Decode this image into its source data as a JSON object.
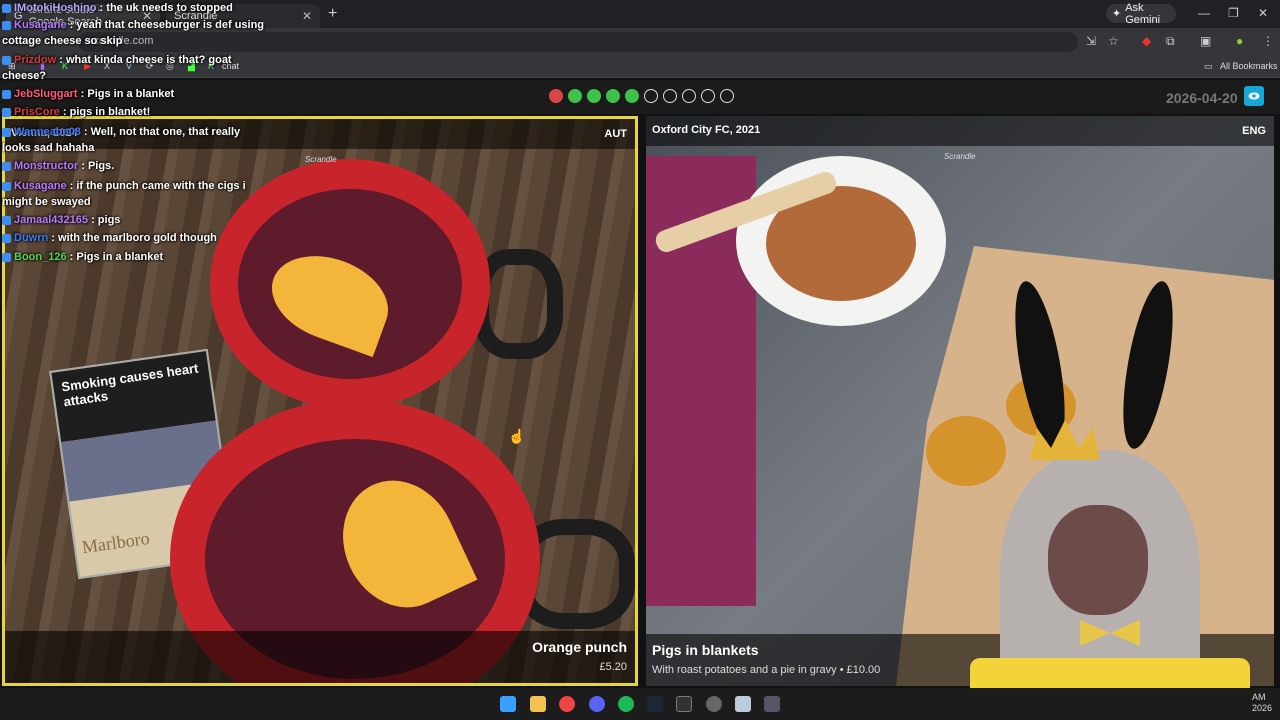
{
  "browser": {
    "tabs": [
      {
        "label": "akrane studio - Google Search"
      },
      {
        "label": "Scrandle"
      }
    ],
    "ask_gemini": "Ask Gemini",
    "url": "scrandle.com",
    "all_bookmarks": "All Bookmarks",
    "bookmark_chat": "chat"
  },
  "game": {
    "progress": [
      "red",
      "green",
      "green",
      "green",
      "green",
      "empty",
      "empty",
      "empty",
      "empty",
      "empty"
    ],
    "date": "2026-04-20",
    "colors": {
      "accent": "#e4d63b",
      "red": "#d94848",
      "green": "#3fc24b",
      "eye": "#15a7d6"
    },
    "left": {
      "location": "Vienna, 2024",
      "lang": "AUT",
      "watermark": "Scrandle",
      "title": "Orange punch",
      "price": "£5.20"
    },
    "right": {
      "location": "Oxford City FC, 2021",
      "lang": "ENG",
      "watermark": "Scrandle",
      "title": "Pigs in blankets",
      "subtitle": "With roast potatoes and a pie in gravy • £10.00"
    }
  },
  "chat": {
    "messages": [
      {
        "user": "IMotokiHoshino",
        "color": "#b9a6ff",
        "text": ": the uk needs to stopped"
      },
      {
        "user": "Kusagane",
        "color": "#b57bff",
        "text": ": yeah that cheeseburger is def using cottage cheese so skip"
      },
      {
        "user": "Prizdow",
        "color": "#d63a3a",
        "text": ": what kinda cheese is that? goat cheese?"
      },
      {
        "user": "JebSluggart",
        "color": "#ff5a7a",
        "text": ": Pigs in a blanket"
      },
      {
        "user": "PrisCore",
        "color": "#d63a3a",
        "text": ": pigs in blanket!"
      },
      {
        "user": "Wanneabe08",
        "color": "#3e7bff",
        "text": ": Well, not that one, that really looks sad hahaha"
      },
      {
        "user": "Monstructor",
        "color": "#b57bff",
        "text": ": Pigs."
      },
      {
        "user": "Kusagane",
        "color": "#b57bff",
        "text": ": if the punch came with the cigs i might be swayed"
      },
      {
        "user": "Jamaal432165",
        "color": "#b57bff",
        "text": ": pigs"
      },
      {
        "user": "Duwrn",
        "color": "#3e7bff",
        "text": ": with the marlboro gold though"
      },
      {
        "user": "Boon_126",
        "color": "#58d35a",
        "text": ": Pigs in a blanket"
      }
    ]
  },
  "photo_left": {
    "box_warning": "Smoking causes heart attacks",
    "box_brand": "Marlboro"
  },
  "taskbar": {
    "time": "AM",
    "year": "2026"
  }
}
